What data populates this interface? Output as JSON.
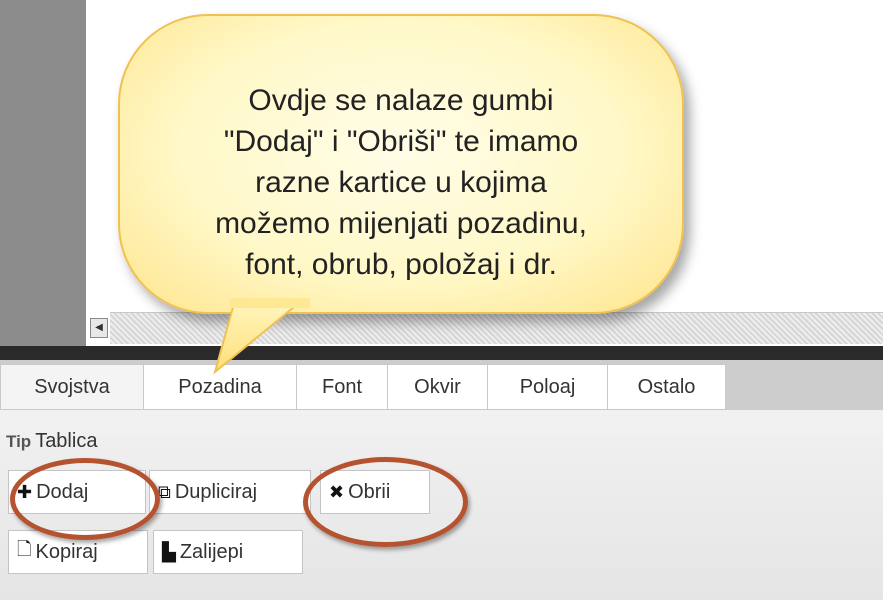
{
  "callout": {
    "lines": [
      "Ovdje se nalaze gumbi",
      "\"Dodaj\" i \"Obriši\" te imamo",
      "razne kartice u kojima",
      "možemo mijenjati pozadinu,",
      "font, obrub, položaj i dr."
    ]
  },
  "tabs": [
    "Svojstva",
    "Pozadina",
    "Font",
    "Okvir",
    "Poloaj",
    "Ostalo"
  ],
  "tip": {
    "label": "Tip",
    "value": "Tablica"
  },
  "buttons": {
    "dodaj": "Dodaj",
    "dupliciraj": "Dupliciraj",
    "obrisi": "Obrii",
    "kopiraj": "Kopiraj",
    "zalijepi": "Zalijepi"
  },
  "icons": {
    "dodaj": "plus-icon",
    "dupliciraj": "duplicate-icon",
    "obrisi": "x-icon",
    "kopiraj": "copy-icon",
    "zalijepi": "paste-icon",
    "scroll_left": "scroll-left-arrow-icon"
  },
  "colors": {
    "callout_fill": "#fff8c8",
    "callout_border": "#f0c050",
    "highlight_circle": "#b5522f"
  }
}
